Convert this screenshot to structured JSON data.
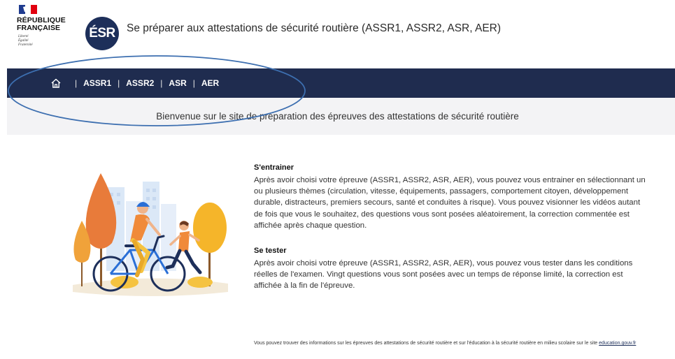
{
  "header": {
    "rf_line1": "RÉPUBLIQUE",
    "rf_line2": "FRANÇAISE",
    "motto_line1": "Liberté",
    "motto_line2": "Égalité",
    "motto_line3": "Fraternité",
    "logo_text": "ÉSR",
    "title": "Se préparer aux attestations de sécurité routière (ASSR1, ASSR2, ASR, AER)"
  },
  "nav": {
    "home_icon": "home-icon",
    "separator": "|",
    "items": [
      {
        "label": "ASSR1"
      },
      {
        "label": "ASSR2"
      },
      {
        "label": "ASR"
      },
      {
        "label": "AER"
      }
    ]
  },
  "welcome": {
    "text": "Bienvenue sur le site de préparation des épreuves des attestations de sécurité routière"
  },
  "sections": [
    {
      "title": "S'entrainer",
      "body": "Après avoir choisi votre épreuve (ASSR1, ASSR2, ASR, AER), vous pouvez vous entrainer en sélectionnant un ou plusieurs thèmes (circulation, vitesse, équipements, passagers, comportement citoyen, développement durable, distracteurs, premiers secours, santé et conduites à risque). Vous pouvez visionner les vidéos autant de fois que vous le souhaitez, des questions vous sont posées aléatoirement, la correction commentée est affichée après chaque question."
    },
    {
      "title": "Se tester",
      "body": "Après avoir choisi votre épreuve (ASSR1, ASSR2, ASR, AER), vous pouvez vous tester dans les conditions réelles de l'examen. Vingt questions vous sont posées avec un temps de réponse limité, la correction est affichée à la fin de l'épreuve."
    }
  ],
  "footnote": {
    "text": "Vous pouvez trouver des informations sur les épreuves des attestations de sécurité routière et sur l'éducation à la sécurité routière en milieu scolaire sur le site ",
    "link": "education.gouv.fr"
  },
  "colors": {
    "nav_bg": "#1f2c4f",
    "logo_bg": "#1d2f5a",
    "annotation_oval": "#3d6fb0",
    "welcome_bg": "#f3f3f5"
  }
}
